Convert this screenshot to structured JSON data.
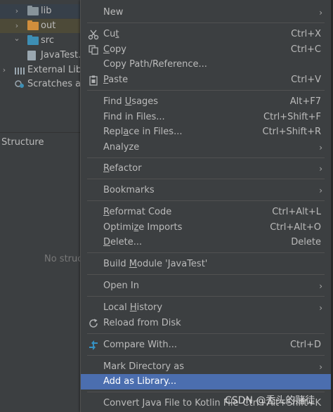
{
  "project_tree": {
    "items": [
      {
        "label": "lib",
        "type": "folder",
        "arrow": "›",
        "icon_color": "#87939a",
        "row_style": "highlight"
      },
      {
        "label": "out",
        "type": "folder",
        "arrow": "›",
        "icon_color": "#d08e3c",
        "row_style": "excluded"
      },
      {
        "label": "src",
        "type": "folder",
        "arrow": "⌄",
        "icon_color": "#3d8eb4",
        "row_style": ""
      },
      {
        "label": "JavaTest.i",
        "type": "file",
        "arrow": "",
        "icon_color": "#9aa7b0",
        "row_style": ""
      },
      {
        "label": "External Libr",
        "type": "library",
        "arrow": "›",
        "icon_color": "#9aa7b0",
        "row_style": ""
      },
      {
        "label": "Scratches an",
        "type": "scratch",
        "arrow": "",
        "icon_color": "#9aa7b0",
        "row_style": ""
      }
    ]
  },
  "structure_panel": {
    "title": "Structure",
    "empty_text": "No struc"
  },
  "context_menu": {
    "items": {
      "new": {
        "label": "New"
      },
      "cut": {
        "label_pre": "Cu",
        "label_u": "t",
        "label_post": "",
        "shortcut": "Ctrl+X",
        "icon": "scissors-icon"
      },
      "copy": {
        "label_pre": "",
        "label_u": "C",
        "label_post": "opy",
        "shortcut": "Ctrl+C",
        "icon": "copy-icon"
      },
      "copy_path": {
        "label": "Copy Path/Reference..."
      },
      "paste": {
        "label_pre": "",
        "label_u": "P",
        "label_post": "aste",
        "shortcut": "Ctrl+V",
        "icon": "paste-icon"
      },
      "find_usages": {
        "label_pre": "Find ",
        "label_u": "U",
        "label_post": "sages",
        "shortcut": "Alt+F7"
      },
      "find_in_files": {
        "label": "Find in Files...",
        "shortcut": "Ctrl+Shift+F"
      },
      "replace_in_files": {
        "label_pre": "Repl",
        "label_u": "a",
        "label_post": "ce in Files...",
        "shortcut": "Ctrl+Shift+R"
      },
      "analyze": {
        "label": "Analyze"
      },
      "refactor": {
        "label_pre": "",
        "label_u": "R",
        "label_post": "efactor"
      },
      "bookmarks": {
        "label": "Bookmarks"
      },
      "reformat_code": {
        "label_pre": "",
        "label_u": "R",
        "label_post": "eformat Code",
        "shortcut": "Ctrl+Alt+L"
      },
      "optimize_imports": {
        "label_pre": "Optimi",
        "label_u": "z",
        "label_post": "e Imports",
        "shortcut": "Ctrl+Alt+O"
      },
      "delete": {
        "label_pre": "",
        "label_u": "D",
        "label_post": "elete...",
        "shortcut": "Delete"
      },
      "build_module": {
        "label_pre": "Build ",
        "label_u": "M",
        "label_post": "odule 'JavaTest'"
      },
      "open_in": {
        "label": "Open In"
      },
      "local_history": {
        "label_pre": "Local ",
        "label_u": "H",
        "label_post": "istory"
      },
      "reload_from_disk": {
        "label": "Reload from Disk",
        "icon": "reload-icon"
      },
      "compare_with": {
        "label": "Compare With...",
        "shortcut": "Ctrl+D",
        "icon": "compare-icon"
      },
      "mark_directory": {
        "label": "Mark Directory as"
      },
      "add_as_library": {
        "label": "Add as Library..."
      },
      "convert_java": {
        "label": "Convert Java File to Kotlin File",
        "shortcut": "Ctrl+Alt+Shift+K"
      }
    },
    "submenu_arrow": "›"
  },
  "colors": {
    "menu_background": "#3c3f41",
    "selection": "#4b6eaf",
    "separator": "#515151",
    "text": "#bbbbbb",
    "compare_icon": "#3592c4"
  },
  "watermark": {
    "text": "CSDN @秃头的赌徒"
  }
}
